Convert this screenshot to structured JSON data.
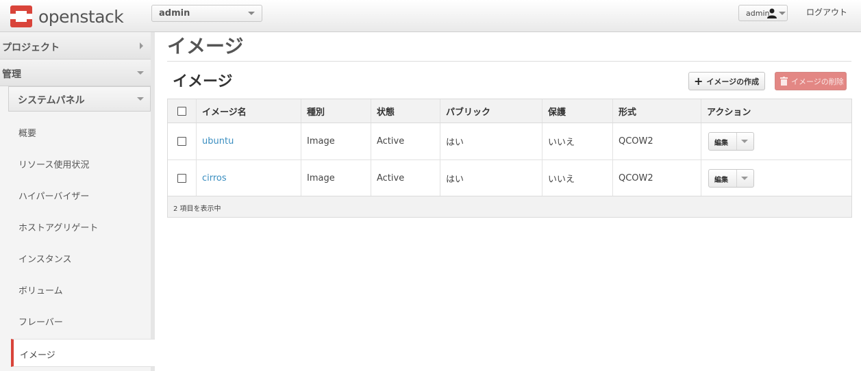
{
  "header": {
    "brand": "openstack",
    "project": "admin",
    "user": "admin",
    "logout": "ログアウト"
  },
  "sidebar": {
    "project": "プロジェクト",
    "admin": "管理",
    "system_panel": "システムパネル",
    "items": [
      "概要",
      "リソース使用状況",
      "ハイパーバイザー",
      "ホストアグリゲート",
      "インスタンス",
      "ボリューム",
      "フレーバー"
    ],
    "active": "イメージ"
  },
  "main": {
    "page_title": "イメージ",
    "section_title": "イメージ",
    "create_button": "イメージの作成",
    "delete_button": "イメージの削除"
  },
  "table": {
    "columns": [
      "イメージ名",
      "種別",
      "状態",
      "パブリック",
      "保護",
      "形式",
      "アクション"
    ],
    "rows": [
      {
        "name": "ubuntu",
        "type": "Image",
        "status": "Active",
        "public": "はい",
        "protected": "いいえ",
        "format": "QCOW2",
        "action": "編集"
      },
      {
        "name": "cirros",
        "type": "Image",
        "status": "Active",
        "public": "はい",
        "protected": "いいえ",
        "format": "QCOW2",
        "action": "編集"
      }
    ],
    "footer": "2 項目を表示中"
  },
  "colors": {
    "accent_red": "#d9443a",
    "link_blue": "#3a8ec0",
    "delete_button": "#e38784"
  }
}
